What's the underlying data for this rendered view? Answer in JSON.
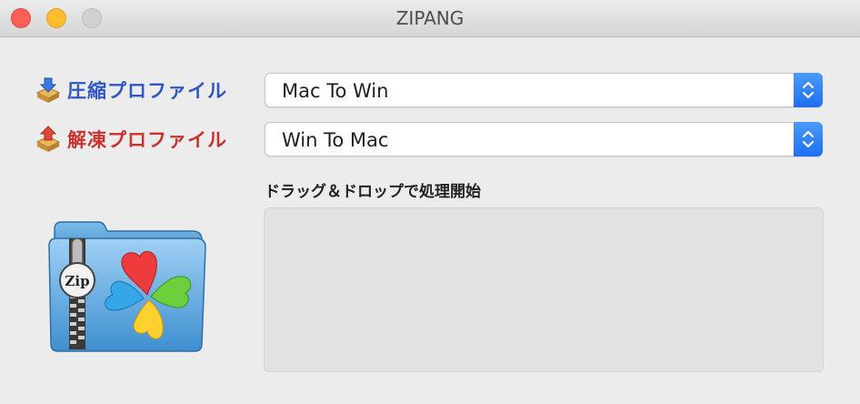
{
  "window": {
    "title": "ZIPANG"
  },
  "compress": {
    "label": "圧縮プロファイル",
    "selected": "Mac To Win"
  },
  "extract": {
    "label": "解凍プロファイル",
    "selected": "Win To Mac"
  },
  "dropzone": {
    "label": "ドラッグ＆ドロップで処理開始"
  },
  "app_icon": {
    "badge": "Zip"
  },
  "colors": {
    "compress_label": "#2e57c8",
    "extract_label": "#c8332e",
    "accent": "#1d6ff2"
  }
}
